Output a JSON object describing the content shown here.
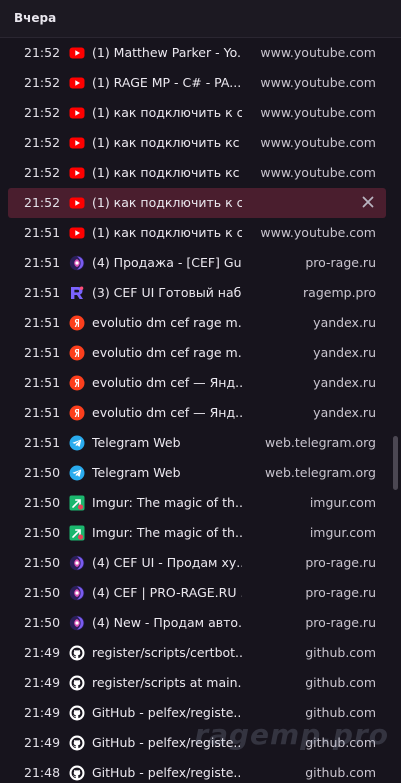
{
  "header": {
    "title": "Вчера"
  },
  "watermark": "ragemp.pro",
  "rows": [
    {
      "time": "21:52",
      "icon": "youtube-icon",
      "title": "(1) Matthew Parker - Yo...",
      "domain": "www.youtube.com",
      "selected": false
    },
    {
      "time": "21:52",
      "icon": "youtube-icon",
      "title": "(1) RAGE MP - C# - PA...",
      "domain": "www.youtube.com",
      "selected": false
    },
    {
      "time": "21:52",
      "icon": "youtube-icon",
      "title": "(1) как подключить к с...",
      "domain": "www.youtube.com",
      "selected": false
    },
    {
      "time": "21:52",
      "icon": "youtube-icon",
      "title": "(1) как подключить кс ...",
      "domain": "www.youtube.com",
      "selected": false
    },
    {
      "time": "21:52",
      "icon": "youtube-icon",
      "title": "(1) как подключить кс ...",
      "domain": "www.youtube.com",
      "selected": false
    },
    {
      "time": "21:52",
      "icon": "youtube-icon",
      "title": "(1) как подключить к с...",
      "domain": "",
      "selected": true
    },
    {
      "time": "21:51",
      "icon": "youtube-icon",
      "title": "(1) как подключить к с...",
      "domain": "www.youtube.com",
      "selected": false
    },
    {
      "time": "21:51",
      "icon": "pro-rage-icon",
      "title": "(4) Продажа - [CEF] Gu...",
      "domain": "pro-rage.ru",
      "selected": false
    },
    {
      "time": "21:51",
      "icon": "ragemp-icon",
      "title": "(3) CEF UI Готовый наб...",
      "domain": "ragemp.pro",
      "selected": false
    },
    {
      "time": "21:51",
      "icon": "yandex-icon",
      "title": "evolutio dm cef rage m...",
      "domain": "yandex.ru",
      "selected": false
    },
    {
      "time": "21:51",
      "icon": "yandex-icon",
      "title": "evolutio dm cef rage m...",
      "domain": "yandex.ru",
      "selected": false
    },
    {
      "time": "21:51",
      "icon": "yandex-icon",
      "title": "evolutio dm cef — Янд...",
      "domain": "yandex.ru",
      "selected": false
    },
    {
      "time": "21:51",
      "icon": "yandex-icon",
      "title": "evolutio dm cef — Янд...",
      "domain": "yandex.ru",
      "selected": false
    },
    {
      "time": "21:51",
      "icon": "telegram-icon",
      "title": "Telegram Web",
      "domain": "web.telegram.org",
      "selected": false
    },
    {
      "time": "21:50",
      "icon": "telegram-icon",
      "title": "Telegram Web",
      "domain": "web.telegram.org",
      "selected": false
    },
    {
      "time": "21:50",
      "icon": "imgur-icon",
      "title": "Imgur: The magic of th...",
      "domain": "imgur.com",
      "selected": false
    },
    {
      "time": "21:50",
      "icon": "imgur-icon",
      "title": "Imgur: The magic of th...",
      "domain": "imgur.com",
      "selected": false
    },
    {
      "time": "21:50",
      "icon": "pro-rage-icon",
      "title": "(4) CEF UI - Продам ху...",
      "domain": "pro-rage.ru",
      "selected": false
    },
    {
      "time": "21:50",
      "icon": "pro-rage-icon",
      "title": "(4) CEF | PRO-RAGE.RU ...",
      "domain": "pro-rage.ru",
      "selected": false
    },
    {
      "time": "21:50",
      "icon": "pro-rage-icon",
      "title": "(4) New - Продам авто...",
      "domain": "pro-rage.ru",
      "selected": false
    },
    {
      "time": "21:49",
      "icon": "github-icon",
      "title": "register/scripts/certbot...",
      "domain": "github.com",
      "selected": false
    },
    {
      "time": "21:49",
      "icon": "github-icon",
      "title": "register/scripts at main...",
      "domain": "github.com",
      "selected": false
    },
    {
      "time": "21:49",
      "icon": "github-icon",
      "title": "GitHub - pelfex/registe...",
      "domain": "github.com",
      "selected": false
    },
    {
      "time": "21:49",
      "icon": "github-icon",
      "title": "GitHub - pelfex/registe...",
      "domain": "github.com",
      "selected": false
    },
    {
      "time": "21:48",
      "icon": "github-icon",
      "title": "GitHub - pelfex/registe...",
      "domain": "github.com",
      "selected": false
    }
  ],
  "colors": {
    "background": "#17141d",
    "selected_row": "#4a1e2e",
    "youtube": "#ff0000",
    "yandex": "#fc3f1d",
    "telegram": "#2aabee",
    "imgur": "#1bb76e"
  }
}
